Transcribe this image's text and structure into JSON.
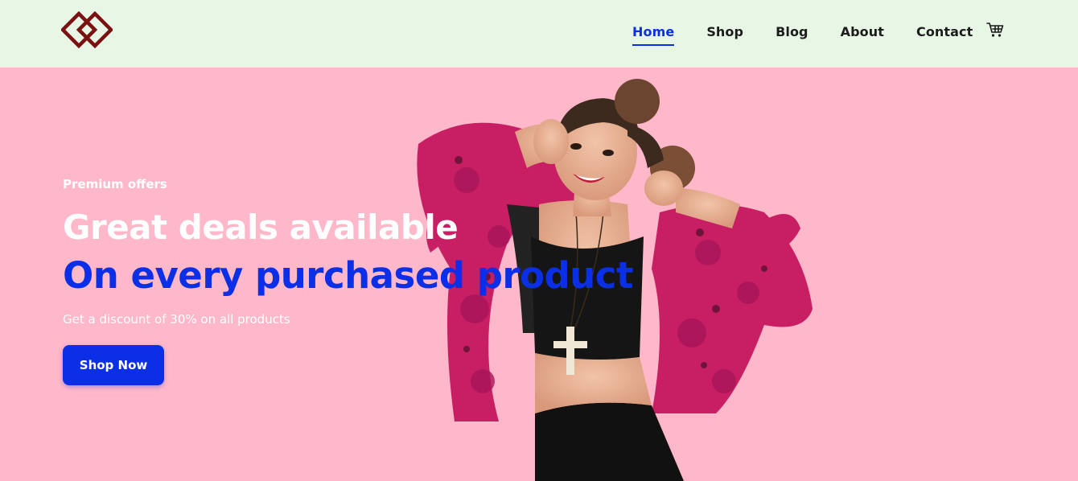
{
  "header": {
    "logo_icon": "diamond-chain-logo-icon",
    "nav": [
      {
        "label": "Home",
        "active": true
      },
      {
        "label": "Shop",
        "active": false
      },
      {
        "label": "Blog",
        "active": false
      },
      {
        "label": "About",
        "active": false
      },
      {
        "label": "Contact",
        "active": false
      }
    ],
    "cart_icon": "shopping-cart-icon"
  },
  "hero": {
    "eyebrow": "Premium offers",
    "headline_line1": "Great deals available",
    "headline_line2": "On every purchased product",
    "subtext": "Get a discount of 30% on all products",
    "cta_label": "Shop Now",
    "image_icon": "woman-in-pink-fur-jacket-photo"
  },
  "colors": {
    "header_bg": "#e8f6e6",
    "hero_bg": "#ffb8c9",
    "accent_blue": "#0b2fe6",
    "logo_red": "#8b1010",
    "jacket_pink": "#d2256d"
  }
}
